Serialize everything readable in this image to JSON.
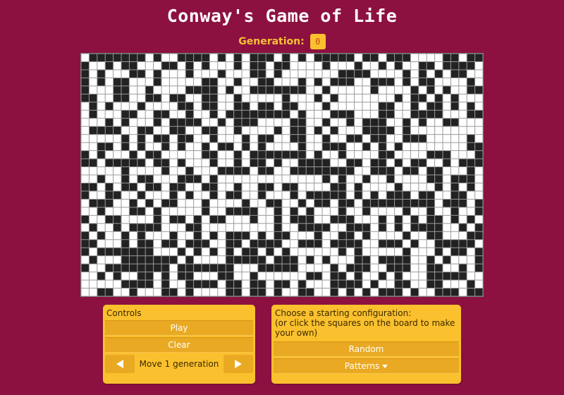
{
  "header": {
    "title": "Conway's Game of Life",
    "generation_label": "Generation:",
    "generation_value": "0"
  },
  "board": {
    "rows": 30,
    "cols": 50,
    "live_color": "#222222",
    "dead_color": "#ffffff",
    "grid_color": "#9a9a9a",
    "cells": [
      "01111111010011110101011101010111110110111000011011",
      "10010110001101010001011011000010001001010011011110",
      "10100011010001000100011010000000111100001010101100",
      "10101100010000011001001100010101110011101011000010",
      "10001100100001111010011111110010000010000101010011",
      "11001100110110011001000001000101000000010110101000",
      "01010001000011011001101101100010000001100101101010",
      "01000110011001001011111111010001110001100111100011",
      "00010100010111100101110000110010010111001010011000",
      "01111001100110011001000010110101000111101000000000",
      "00000101011011001000101100110010011011001110000010",
      "00110101001010010110101000010011100101010000000011",
      "10100010110000011001011111110100100001100001110001",
      "11011111011010001001011010011110011011010110010111",
      "00000100001001000111101100111111110011101101100010",
      "00100101100011101000000000000010100100100001101110",
      "11010110110110011001001101100001101000010000101010",
      "10011001000101001011001000101111101010111011001100",
      "01110010101100010000100110010110110111111111011101",
      "00100011010000010011110010101000100100001001001001",
      "10011000010110101100010010111001110001010101101010",
      "01001011110001100000000010011110011101010111100101",
      "10100101000100101011101011000100110100001001100011",
      "11000101101101110011011110011101111001110100111110",
      "10111111100010101010110101000000101000001000101101",
      "01000111111101000011111011101010001101111001010001",
      "10011111111011111110001111100001011100111001100101",
      "00101001101011000110010000001101101001010001111100",
      "00000111101001111011011011010001111010011001100010",
      "00110010001101000011011010011001010101110100111011"
    ]
  },
  "controls": {
    "title": "Controls",
    "play_label": "Play",
    "clear_label": "Clear",
    "step_label": "Move 1 generation",
    "back_icon": "triangle-left-icon",
    "forward_icon": "triangle-right-icon"
  },
  "config": {
    "title_line1": "Choose a starting configuration:",
    "title_line2": "(or click the squares on the board to make your own)",
    "random_label": "Random",
    "patterns_label": "Patterns",
    "patterns_icon": "caret-down-icon"
  }
}
